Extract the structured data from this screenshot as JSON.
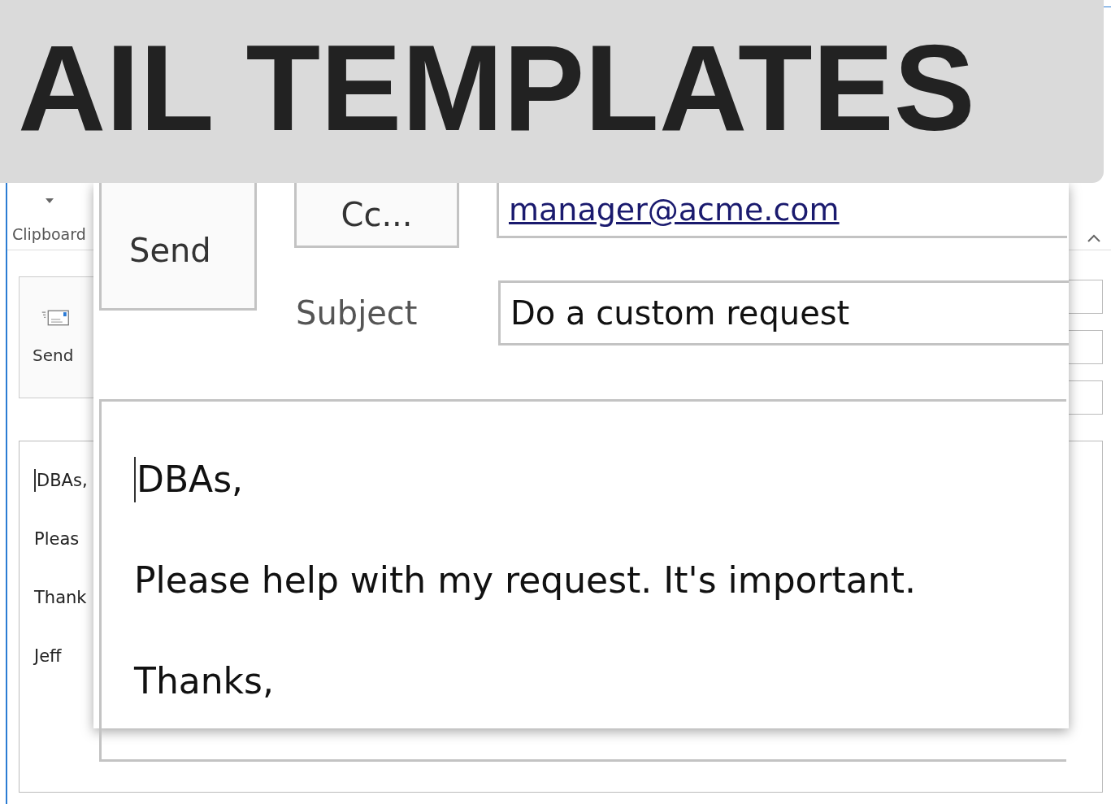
{
  "ribbon": {
    "group_label": "Clipboard"
  },
  "compose": {
    "send_label": "Send",
    "body_lines": [
      "DBAs,",
      "Pleas",
      "Thank",
      "Jeff"
    ]
  },
  "magnified": {
    "send_label": "Send",
    "cc_label": "Cc...",
    "cc_value": "manager@acme.com",
    "subject_label": "Subject",
    "subject_value": "Do a custom request",
    "body_lines": [
      "DBAs,",
      "Please help with my request. It's important.",
      "Thanks,"
    ]
  },
  "banner": {
    "title": "AIL TEMPLATES"
  }
}
